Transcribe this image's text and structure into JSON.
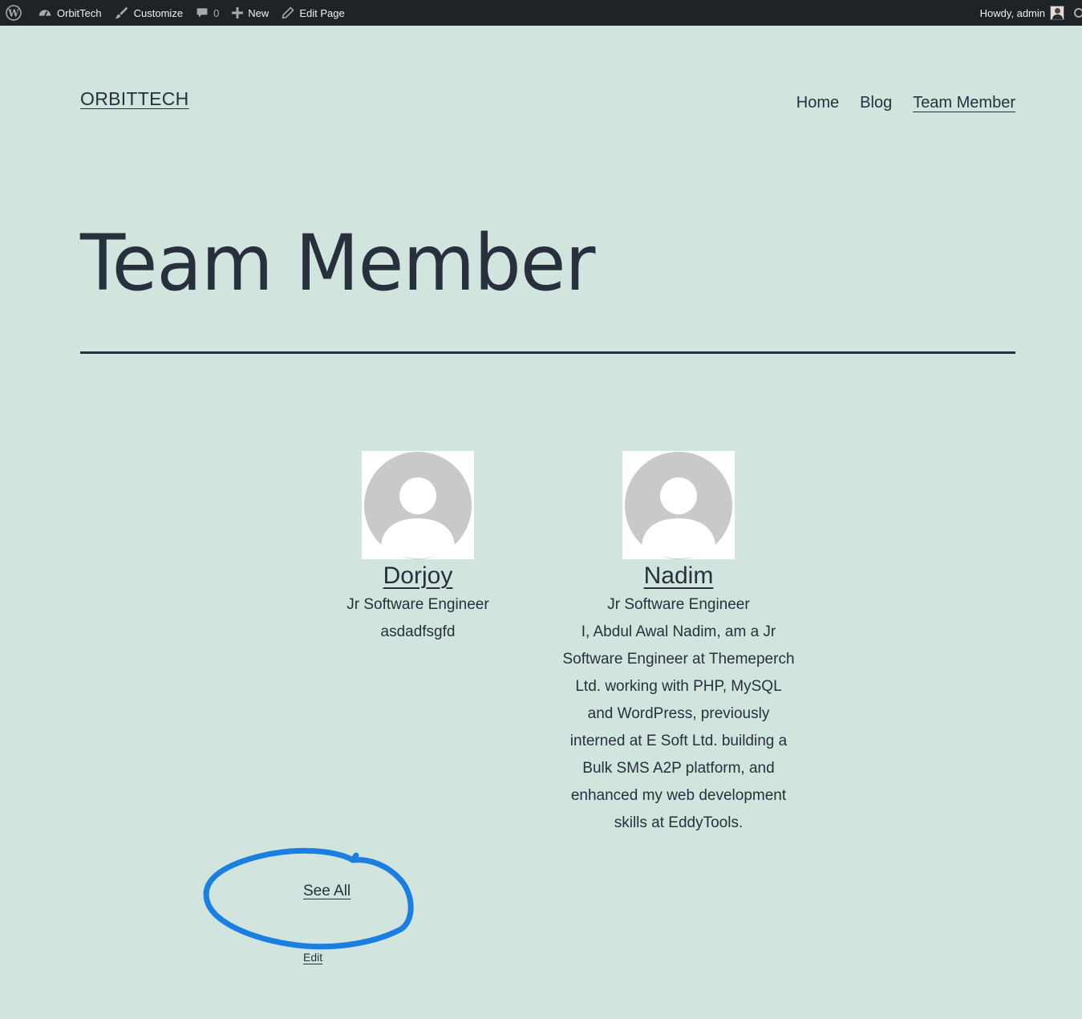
{
  "adminbar": {
    "site_name": "OrbitTech",
    "customize": "Customize",
    "comments_count": "0",
    "new_label": "New",
    "edit_page": "Edit Page",
    "howdy": "Howdy, admin"
  },
  "header": {
    "site_title": "ORBITTECH",
    "nav": [
      "Home",
      "Blog",
      "Team Member"
    ]
  },
  "page": {
    "title": "Team Member"
  },
  "team": [
    {
      "name": "Dorjoy",
      "role": "Jr Software Engineer",
      "bio": "asdadfsgfd"
    },
    {
      "name": "Nadim",
      "role": "Jr Software Engineer",
      "bio": "I, Abdul Awal Nadim, am a Jr Software Engineer at Themeperch Ltd. working with PHP, MySQL and WordPress, previously interned at E Soft Ltd. building a Bulk SMS A2P platform, and enhanced my web development skills at EddyTools."
    }
  ],
  "links": {
    "see_all": "See All",
    "edit": "Edit"
  },
  "colors": {
    "background": "#d1e4dd",
    "text": "#28303d",
    "adminbar": "#1d2327",
    "annotation": "#1a7fe0"
  }
}
